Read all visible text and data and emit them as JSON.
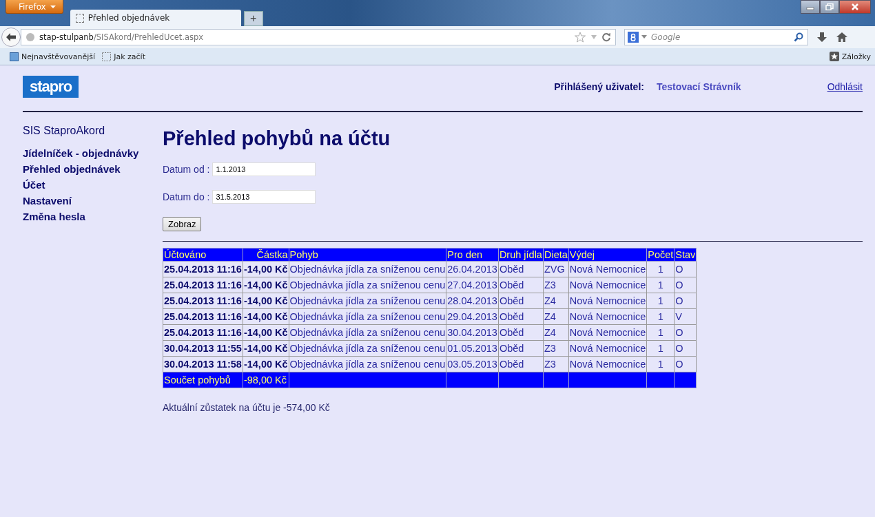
{
  "browser": {
    "menu_button": "Firefox",
    "tabs": [
      {
        "title": "Přehled objednávek",
        "selected": true
      }
    ],
    "new_tab": "+",
    "url": {
      "host": "stap-stulpanb",
      "path": "/SISAkord/PrehledUcet.aspx"
    },
    "search": {
      "placeholder": "Google"
    },
    "bookmarks": [
      "Nejnavštěvovanější",
      "Jak začít"
    ],
    "bookmarks_menu": "Záložky"
  },
  "header": {
    "logo": "stapro",
    "user_label": "Přihlášený uživatel:",
    "user_name": "Testovací Strávník",
    "logout": "Odhlásit"
  },
  "sidebar": {
    "title": "SIS StaproAkord",
    "items": [
      "Jídelníček - objednávky",
      "Přehled objednávek",
      "Účet",
      "Nastavení",
      "Změna hesla"
    ]
  },
  "page": {
    "title": "Přehled pohybů na účtu",
    "filters": [
      {
        "label": "Datum od :",
        "value": "1.1.2013"
      },
      {
        "label": "Datum do :",
        "value": "31.5.2013"
      }
    ],
    "button": "Zobraz",
    "table": {
      "columns": [
        "Účtováno",
        "Částka",
        "Pohyb",
        "Pro den",
        "Druh jídla",
        "Dieta",
        "Výdej",
        "Počet",
        "Stav"
      ],
      "rows": [
        [
          "25.04.2013 11:16",
          "-14,00 Kč",
          "Objednávka jídla za sníženou cenu",
          "26.04.2013",
          "Oběd",
          "ZVG",
          "Nová Nemocnice",
          "1",
          "O"
        ],
        [
          "25.04.2013 11:16",
          "-14,00 Kč",
          "Objednávka jídla za sníženou cenu",
          "27.04.2013",
          "Oběd",
          "Z3",
          "Nová Nemocnice",
          "1",
          "O"
        ],
        [
          "25.04.2013 11:16",
          "-14,00 Kč",
          "Objednávka jídla za sníženou cenu",
          "28.04.2013",
          "Oběd",
          "Z4",
          "Nová Nemocnice",
          "1",
          "O"
        ],
        [
          "25.04.2013 11:16",
          "-14,00 Kč",
          "Objednávka jídla za sníženou cenu",
          "29.04.2013",
          "Oběd",
          "Z4",
          "Nová Nemocnice",
          "1",
          "V"
        ],
        [
          "25.04.2013 11:16",
          "-14,00 Kč",
          "Objednávka jídla za sníženou cenu",
          "30.04.2013",
          "Oběd",
          "Z4",
          "Nová Nemocnice",
          "1",
          "O"
        ],
        [
          "30.04.2013 11:55",
          "-14,00 Kč",
          "Objednávka jídla za sníženou cenu",
          "01.05.2013",
          "Oběd",
          "Z3",
          "Nová Nemocnice",
          "1",
          "O"
        ],
        [
          "30.04.2013 11:58",
          "-14,00 Kč",
          "Objednávka jídla za sníženou cenu",
          "03.05.2013",
          "Oběd",
          "Z3",
          "Nová Nemocnice",
          "1",
          "O"
        ]
      ],
      "total": {
        "label": "Součet pohybů",
        "amount": "-98,00 Kč"
      }
    },
    "balance": "Aktuální zůstatek na účtu je -574,00 Kč"
  }
}
